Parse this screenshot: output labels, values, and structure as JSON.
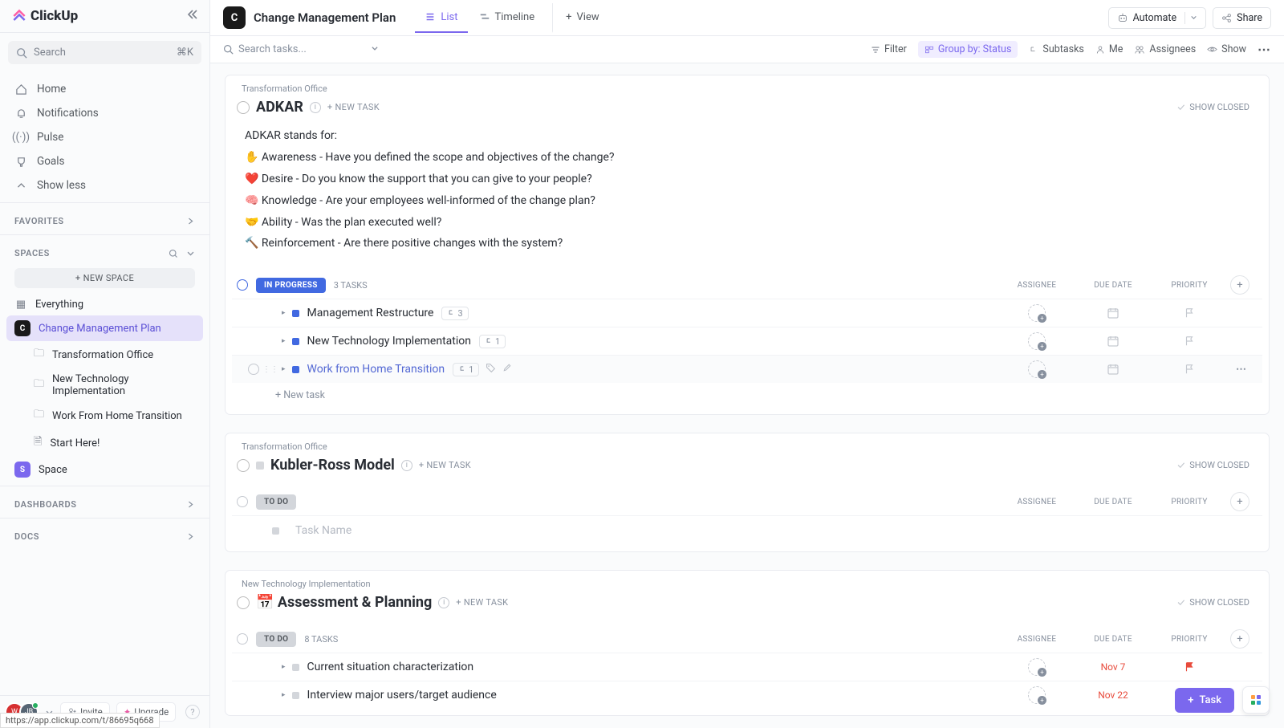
{
  "logo": "ClickUp",
  "sidebar": {
    "search": "Search",
    "shortcut": "⌘K",
    "nav": [
      "Home",
      "Notifications",
      "Pulse",
      "Goals",
      "Show less"
    ],
    "favorites": "FAVORITES",
    "spaces": "SPACES",
    "new_space": "+  NEW SPACE",
    "tree": {
      "everything": "Everything",
      "cmp": "Change Management Plan",
      "folders": [
        "Transformation Office",
        "New Technology Implementation",
        "Work From Home Transition"
      ],
      "start": "Start Here!",
      "space": "Space"
    },
    "dashboards": "DASHBOARDS",
    "docs": "DOCS",
    "invite": "Invite",
    "upgrade": "Upgrade"
  },
  "header": {
    "avatar": "C",
    "title": "Change Management Plan",
    "tabs": {
      "list": "List",
      "timeline": "Timeline",
      "view": "View"
    },
    "automate": "Automate",
    "share": "Share"
  },
  "filters": {
    "search": "Search tasks...",
    "filter": "Filter",
    "group": "Group by: Status",
    "subtasks": "Subtasks",
    "me": "Me",
    "assignees": "Assignees",
    "show": "Show"
  },
  "cols": {
    "assignee": "ASSIGNEE",
    "due": "DUE DATE",
    "priority": "PRIORITY"
  },
  "sections": [
    {
      "crumb": "Transformation Office",
      "title": "ADKAR",
      "new_task": "+ NEW TASK",
      "show_closed": "SHOW CLOSED",
      "desc": [
        "ADKAR stands for:",
        "✋ Awareness - Have you defined the scope and objectives of the change?",
        "❤️ Desire - Do you know the support that you can give to your people?",
        "🧠 Knowledge - Are your employees well-informed of the change plan?",
        "🤝 Ability - Was the plan executed well?",
        "🔨 Reinforcement - Are there positive changes with the system?"
      ],
      "groups": [
        {
          "status": "IN PROGRESS",
          "type": "progress",
          "count": "3 TASKS",
          "tasks": [
            {
              "name": "Management Restructure",
              "sub": "3",
              "hover": false
            },
            {
              "name": "New Technology Implementation",
              "sub": "1",
              "hover": false
            },
            {
              "name": "Work from Home Transition",
              "sub": "1",
              "hover": true,
              "link": true
            }
          ],
          "new_task": "+ New task"
        }
      ]
    },
    {
      "crumb": "Transformation Office",
      "title": "Kubler-Ross Model",
      "new_task": "+ NEW TASK",
      "show_closed": "SHOW CLOSED",
      "show_disc": true,
      "groups": [
        {
          "status": "TO DO",
          "type": "todo",
          "count": "",
          "placeholder": "Task Name"
        }
      ]
    },
    {
      "crumb": "New Technology Implementation",
      "title": "Assessment & Planning",
      "emoji": "📅",
      "new_task": "+ NEW TASK",
      "show_closed": "SHOW CLOSED",
      "groups": [
        {
          "status": "TO DO",
          "type": "todo",
          "count": "8 TASKS",
          "tasks": [
            {
              "name": "Current situation characterization",
              "due": "Nov 7",
              "flag": "red"
            },
            {
              "name": "Interview major users/target audience",
              "due": "Nov 22"
            }
          ]
        }
      ]
    }
  ],
  "fab": {
    "task": "Task"
  },
  "status_url": "https://app.clickup.com/t/86695q668"
}
